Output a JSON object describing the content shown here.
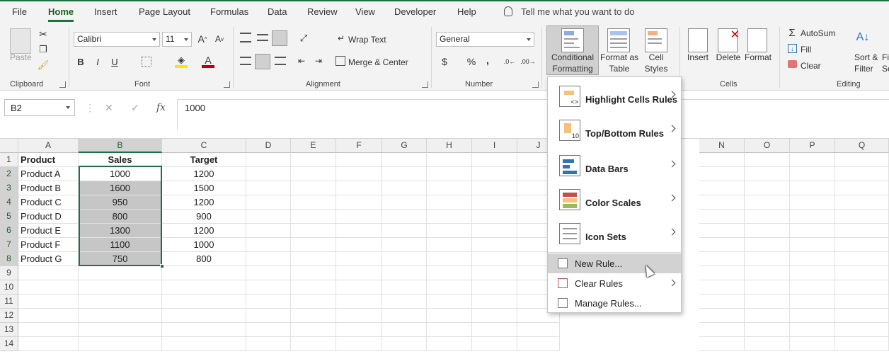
{
  "menu_tabs": [
    "File",
    "Home",
    "Insert",
    "Page Layout",
    "Formulas",
    "Data",
    "Review",
    "View",
    "Developer",
    "Help"
  ],
  "tell_me": "Tell me what you want to do",
  "ribbon": {
    "clipboard": {
      "label": "Clipboard",
      "paste": "Paste"
    },
    "font": {
      "label": "Font",
      "name": "Calibri",
      "size": "11",
      "bold": "B",
      "italic": "I",
      "underline": "U"
    },
    "alignment": {
      "label": "Alignment",
      "wrap": "Wrap Text",
      "merge": "Merge & Center"
    },
    "number": {
      "label": "Number",
      "format": "General",
      "currency": "$",
      "percent": "%",
      "comma": ","
    },
    "styles": {
      "cf_line1": "Conditional",
      "cf_line2": "Formatting",
      "fat_line1": "Format as",
      "fat_line2": "Table",
      "cs_line1": "Cell",
      "cs_line2": "Styles"
    },
    "cells": {
      "label": "Cells",
      "insert": "Insert",
      "delete": "Delete",
      "format": "Format"
    },
    "editing": {
      "label": "Editing",
      "autosum": "AutoSum",
      "fill": "Fill",
      "clear": "Clear",
      "sort1": "Sort &",
      "sort2": "Filter",
      "find1": "Fi",
      "find2": "Se"
    }
  },
  "formula_bar": {
    "name_box": "B2",
    "value": "1000",
    "fx": "fx"
  },
  "columns": [
    "A",
    "B",
    "C",
    "D",
    "E",
    "F",
    "G",
    "H",
    "I",
    "J",
    "N",
    "O",
    "P",
    "Q"
  ],
  "rows": [
    "1",
    "2",
    "3",
    "4",
    "5",
    "6",
    "7",
    "8",
    "9",
    "10",
    "11",
    "12",
    "13",
    "14"
  ],
  "table": {
    "headers": [
      "Product",
      "Sales",
      "Target"
    ],
    "data": [
      [
        "Product A",
        "1000",
        "1200"
      ],
      [
        "Product B",
        "1600",
        "1500"
      ],
      [
        "Product C",
        "950",
        "1200"
      ],
      [
        "Product D",
        "800",
        "900"
      ],
      [
        "Product E",
        "1300",
        "1200"
      ],
      [
        "Product F",
        "1100",
        "1000"
      ],
      [
        "Product G",
        "750",
        "800"
      ]
    ]
  },
  "cf_menu": {
    "highlight": "Highlight Cells Rules",
    "topbottom": "Top/Bottom Rules",
    "databars": "Data Bars",
    "colorscales": "Color Scales",
    "iconsets": "Icon Sets",
    "newrule": "New Rule...",
    "clearrules": "Clear Rules",
    "managerules": "Manage Rules..."
  }
}
